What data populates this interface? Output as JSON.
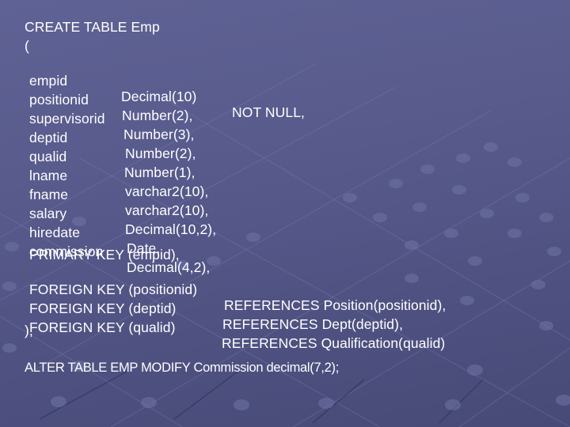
{
  "slide": {
    "create_statement": {
      "header": "CREATE TABLE Emp",
      "open_paren": "(",
      "columns": [
        {
          "name": "empid",
          "type": "Decimal(10)",
          "constraint": "NOT NULL,"
        },
        {
          "name": "positionid",
          "type": "Number(2),"
        },
        {
          "name": "supervisorid",
          "type": "Number(3),"
        },
        {
          "name": "deptid",
          "type": "Number(2),"
        },
        {
          "name": "qualid",
          "type": "Number(1),"
        },
        {
          "name": "lname",
          "type": "varchar2(10),"
        },
        {
          "name": "fname",
          "type": "varchar2(10),"
        },
        {
          "name": "salary",
          "type": "Decimal(10,2),"
        },
        {
          "name": "hiredate",
          "type": "Date,"
        },
        {
          "name": "commission",
          "type": "Decimal(4,2),"
        }
      ],
      "primary_key": "PRIMARY KEY (empid),",
      "foreign_keys": [
        {
          "key": "FOREIGN KEY (positionid)",
          "ref": "REFERENCES Position(positionid),"
        },
        {
          "key": "FOREIGN KEY (deptid)",
          "ref": "REFERENCES Dept(deptid),"
        },
        {
          "key": "FOREIGN KEY (qualid)",
          "ref": "REFERENCES Qualification(qualid)"
        }
      ],
      "close": ");"
    },
    "alter_statement": "ALTER TABLE EMP MODIFY Commission decimal(7,2);"
  },
  "colors": {
    "text": "#ffffff",
    "background": "#585b8c"
  }
}
